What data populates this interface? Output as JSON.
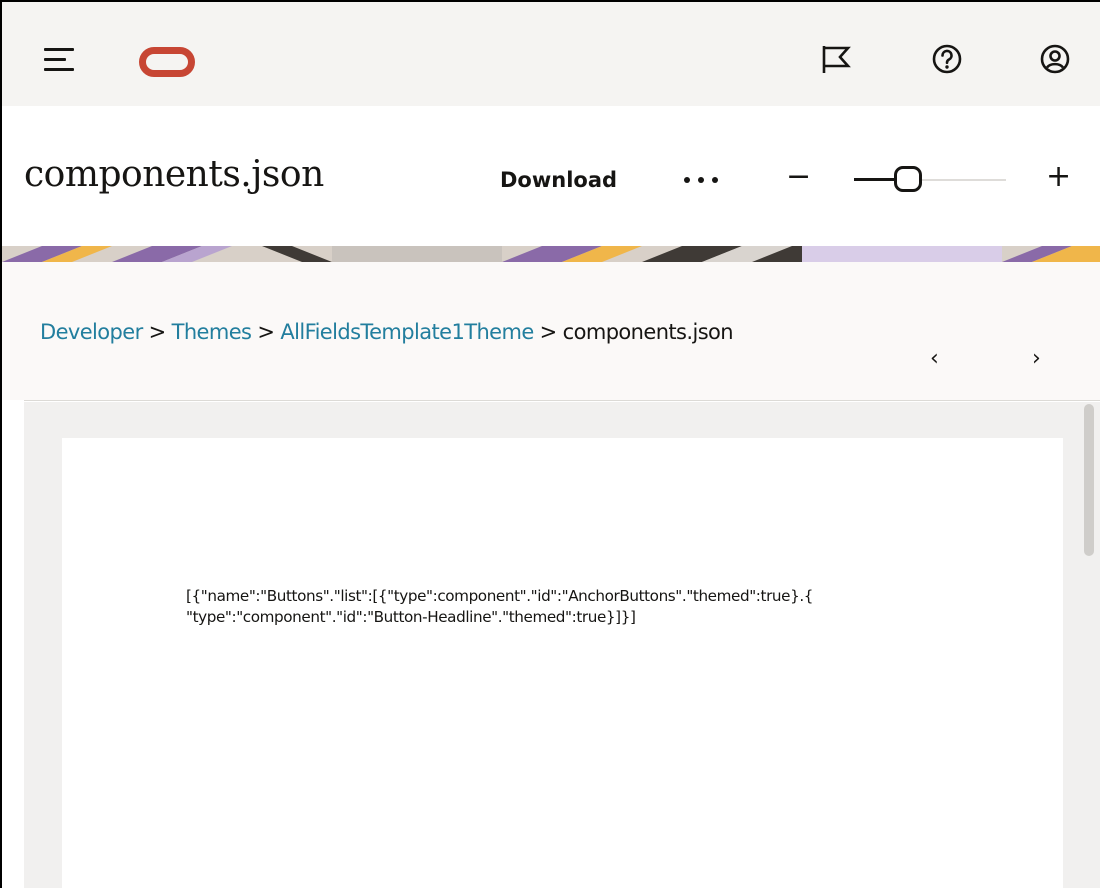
{
  "header": {
    "menu_icon": "hamburger-menu-icon",
    "logo": "oracle-logo",
    "icons": [
      "flag-icon",
      "help-icon",
      "user-profile-icon"
    ]
  },
  "document": {
    "title": "components.json",
    "download_label": "Download",
    "more_icon": "more-options-icon",
    "zoom": {
      "minus_label": "−",
      "plus_label": "+",
      "level": 0.32
    }
  },
  "breadcrumb": {
    "items": [
      {
        "label": "Developer",
        "link": true
      },
      {
        "label": "Themes",
        "link": true
      },
      {
        "label": "AllFieldsTemplate1Theme",
        "link": true
      },
      {
        "label": "components.json",
        "link": false
      }
    ],
    "separator": ">",
    "prev_icon": "‹",
    "next_icon": "›"
  },
  "content": {
    "lines": [
      "[{\"name\":\"Buttons\".\"list\":[{\"type\":component\".\"id\":\"AnchorButtons\".\"themed\":true}.{",
      "\"type\":\"component\".\"id\":\"Button-Headline\".\"themed\":true}]}]"
    ]
  },
  "colors": {
    "accent": "#c74634",
    "link": "#227e9e",
    "text": "#161513",
    "band": [
      "#8a6aa8",
      "#f0b64a",
      "#3f3a36",
      "#d9cde8",
      "#c9c3bd"
    ]
  }
}
